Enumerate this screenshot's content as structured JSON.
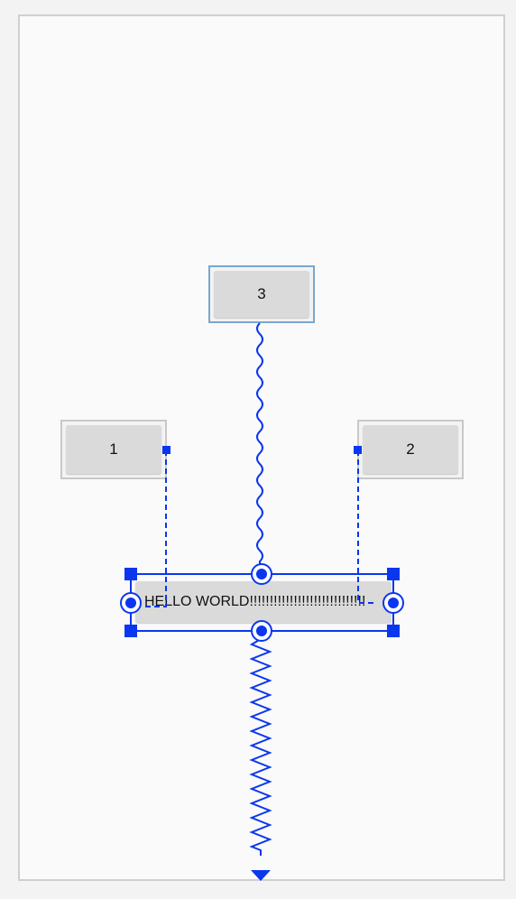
{
  "buttons": {
    "one": {
      "label": "1"
    },
    "two": {
      "label": "2"
    },
    "three": {
      "label": "3"
    },
    "hello": {
      "label": "HELLO WORLD!!!!!!!!!!!!!!!!!!!!!!!!!!!!!"
    }
  },
  "colors": {
    "constraint": "#0a36f0",
    "frame": "#c8c8c8",
    "selected_frame": "#7aa6cf"
  }
}
